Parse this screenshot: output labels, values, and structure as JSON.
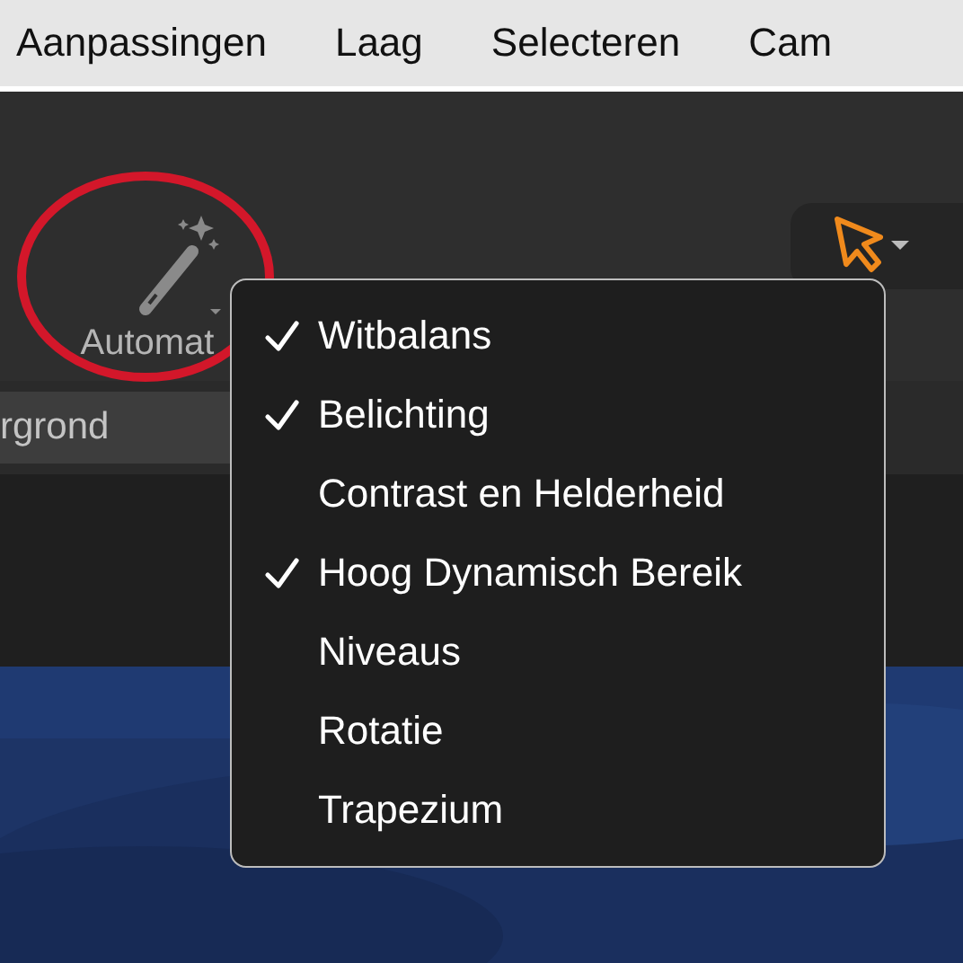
{
  "menu_bar": {
    "items": [
      {
        "label": "Aanpassingen"
      },
      {
        "label": "Laag"
      },
      {
        "label": "Selecteren"
      },
      {
        "label": "Cam"
      }
    ]
  },
  "toolbar": {
    "auto_button": {
      "label": "Automat"
    },
    "field": {
      "value": "rgrond"
    }
  },
  "dropdown": {
    "items": [
      {
        "label": "Witbalans",
        "checked": true
      },
      {
        "label": "Belichting",
        "checked": true
      },
      {
        "label": "Contrast en Helderheid",
        "checked": false
      },
      {
        "label": "Hoog Dynamisch Bereik",
        "checked": true
      },
      {
        "label": "Niveaus",
        "checked": false
      },
      {
        "label": "Rotatie",
        "checked": false
      },
      {
        "label": "Trapezium",
        "checked": false
      }
    ]
  }
}
